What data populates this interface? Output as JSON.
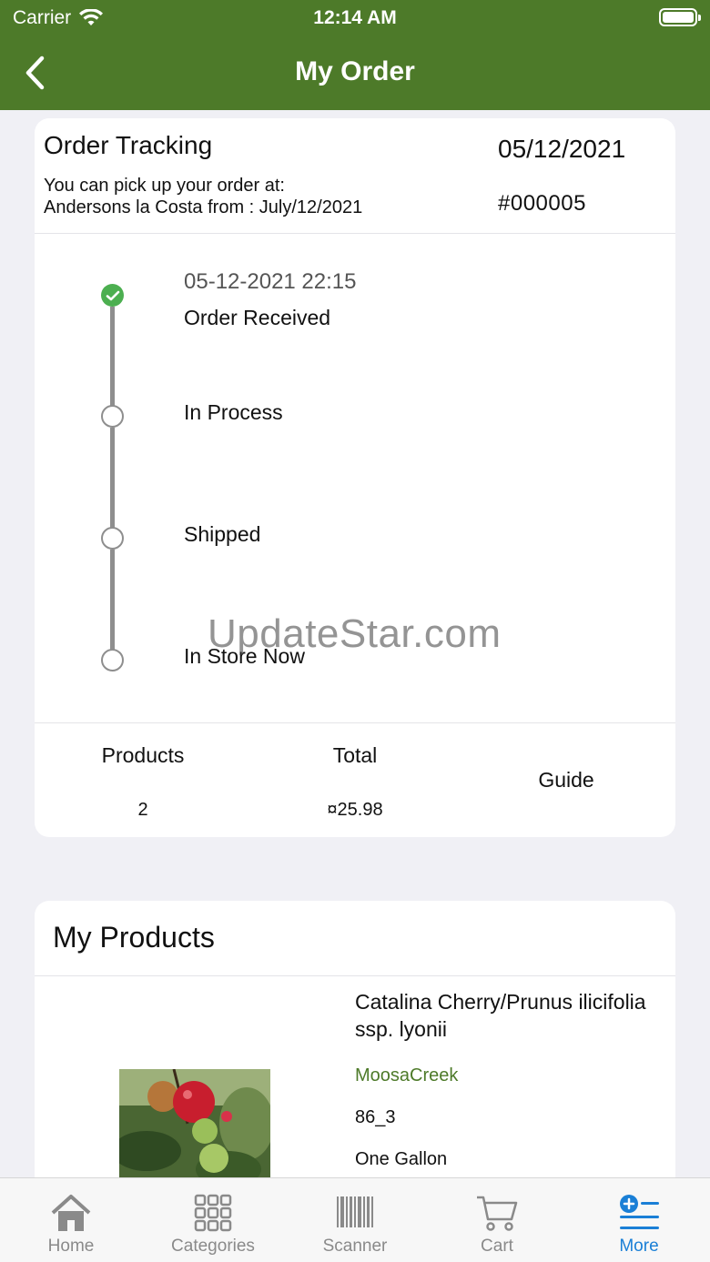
{
  "status_bar": {
    "carrier": "Carrier",
    "time": "12:14 AM"
  },
  "nav": {
    "title": "My Order"
  },
  "order": {
    "heading": "Order Tracking",
    "date": "05/12/2021",
    "pickup_line1": "You can pick up your order at:",
    "pickup_line2": "Andersons la Costa from : July/12/2021",
    "number": "#000005"
  },
  "timeline": [
    {
      "time": "05-12-2021 22:15",
      "label": "Order Received",
      "done": true
    },
    {
      "time": "",
      "label": "In Process",
      "done": false
    },
    {
      "time": "",
      "label": "Shipped",
      "done": false
    },
    {
      "time": "",
      "label": "In Store Now",
      "done": false
    }
  ],
  "summary": {
    "products_label": "Products",
    "products_value": "2",
    "total_label": "Total",
    "total_value": "¤25.98",
    "guide_label": "Guide"
  },
  "products_section": {
    "title": "My Products",
    "items": [
      {
        "name": "Catalina Cherry/Prunus ilicifolia ssp. lyonii",
        "brand": "MoosaCreek",
        "sku": "86_3",
        "size": "One Gallon"
      }
    ]
  },
  "watermark": "UpdateStar.com",
  "tabbar": {
    "tabs": [
      {
        "label": "Home",
        "icon": "home-icon"
      },
      {
        "label": "Categories",
        "icon": "grid-icon"
      },
      {
        "label": "Scanner",
        "icon": "barcode-icon"
      },
      {
        "label": "Cart",
        "icon": "cart-icon"
      },
      {
        "label": "More",
        "icon": "more-list-icon"
      }
    ],
    "active": "More"
  },
  "colors": {
    "nav_green": "#4d7a29",
    "check_green": "#4caf50",
    "active_blue": "#1a7fd6",
    "brand_green": "#4d7a29"
  }
}
